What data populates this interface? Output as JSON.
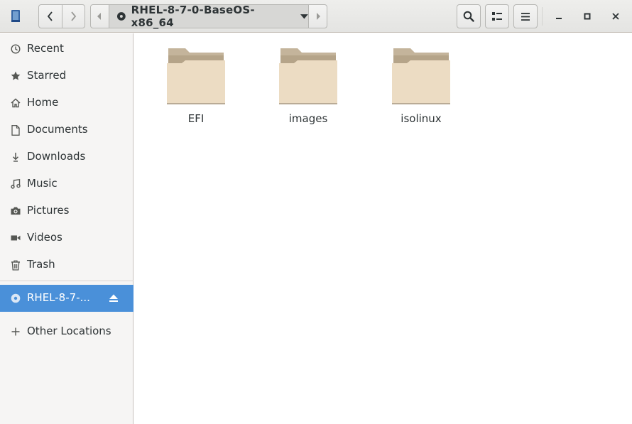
{
  "window": {
    "app_icon": "files-app-icon",
    "path": "RHEL-8-7-0-BaseOS-x86_64",
    "nav": {
      "back_icon": "chevron-left-icon",
      "forward_icon": "chevron-right-icon"
    },
    "toolbar": {
      "search_icon": "search-icon",
      "view_icon": "list-view-icon",
      "menu_icon": "hamburger-menu-icon"
    },
    "controls": [
      "minimize",
      "maximize",
      "close"
    ]
  },
  "sidebar": {
    "places": [
      {
        "label": "Recent",
        "icon": "clock-icon"
      },
      {
        "label": "Starred",
        "icon": "star-icon"
      },
      {
        "label": "Home",
        "icon": "home-icon"
      },
      {
        "label": "Documents",
        "icon": "document-icon"
      },
      {
        "label": "Downloads",
        "icon": "download-icon"
      },
      {
        "label": "Music",
        "icon": "music-icon"
      },
      {
        "label": "Pictures",
        "icon": "camera-icon"
      },
      {
        "label": "Videos",
        "icon": "video-icon"
      },
      {
        "label": "Trash",
        "icon": "trash-icon"
      }
    ],
    "device": {
      "label": "RHEL-8-7-...",
      "icon": "disc-icon",
      "eject_icon": "eject-icon",
      "selected": true
    },
    "other": {
      "label": "Other Locations",
      "icon": "plus-icon"
    }
  },
  "files": [
    {
      "name": "EFI",
      "type": "folder"
    },
    {
      "name": "images",
      "type": "folder"
    },
    {
      "name": "isolinux",
      "type": "folder"
    }
  ],
  "colors": {
    "accent": "#4a90d9",
    "folder_back": "#c4b49b",
    "folder_front": "#ecdcc3"
  }
}
